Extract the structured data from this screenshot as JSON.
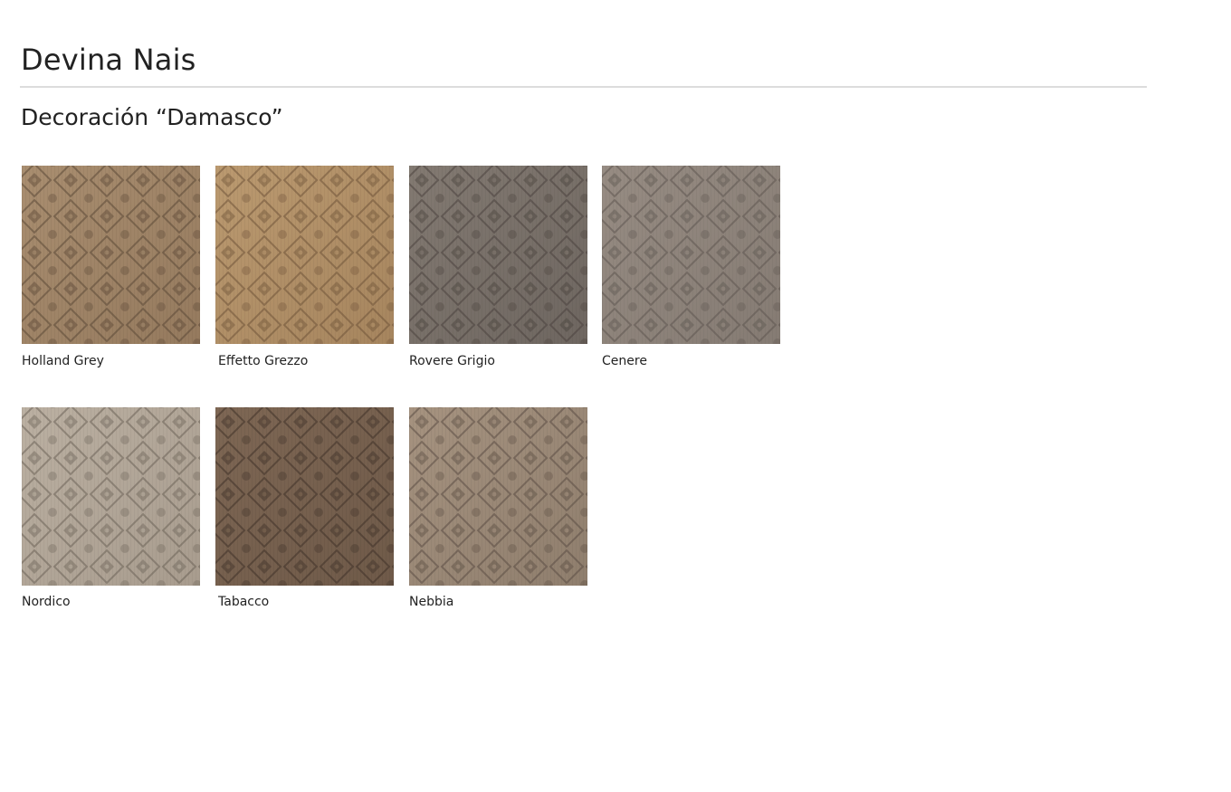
{
  "header": {
    "title": "Devina Nais",
    "subtitle": "Decoración “Damasco”"
  },
  "swatches": [
    {
      "label": "Holland Grey",
      "base": "#957a5e",
      "light": "#a98e70",
      "pattern": "#5a4836"
    },
    {
      "label": "Effetto Grezzo",
      "base": "#a6855e",
      "light": "#bb9a70",
      "pattern": "#6e5438"
    },
    {
      "label": "Rovere Grigio",
      "base": "#6e6660",
      "light": "#837a72",
      "pattern": "#4a423d"
    },
    {
      "label": "Cenere",
      "base": "#857b73",
      "light": "#978c83",
      "pattern": "#5e5650"
    },
    {
      "label": "Nordico",
      "base": "#a89c8e",
      "light": "#bbb0a2",
      "pattern": "#6c6358"
    },
    {
      "label": "Tabacco",
      "base": "#6f5a49",
      "light": "#7e6754",
      "pattern": "#3f3128"
    },
    {
      "label": "Nebbia",
      "base": "#8f7e6d",
      "light": "#a69380",
      "pattern": "#5a4d43"
    }
  ]
}
